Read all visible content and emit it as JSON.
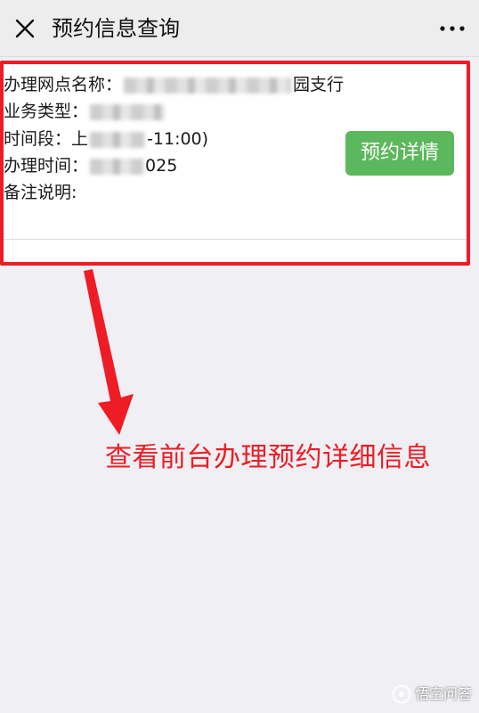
{
  "header": {
    "title": "预约信息查询"
  },
  "record": {
    "branch_label": "办理网点名称：",
    "branch_value_suffix": "园支行",
    "business_type_label": "业务类型：",
    "time_slot_label": "时间段：",
    "time_slot_prefix": "上",
    "time_slot_suffix": "-11:00)",
    "handle_time_label": "办理时间：",
    "handle_time_suffix": "025",
    "remark_label": "备注说明:",
    "detail_button": "预约详情"
  },
  "annotation": {
    "text": "查看前台办理预约详细信息"
  },
  "watermark": {
    "text": "悟空问答"
  },
  "colors": {
    "highlight": "#ee1c24",
    "button": "#5cb85c",
    "background": "#efeff4"
  }
}
